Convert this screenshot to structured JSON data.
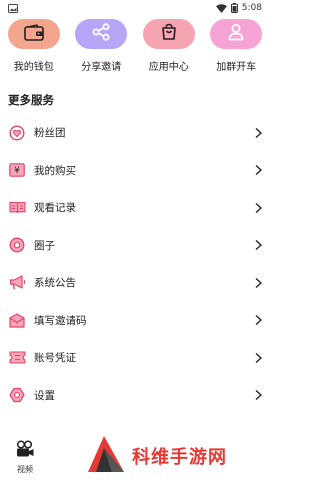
{
  "status_bar": {
    "time": "5:08"
  },
  "quick_actions": [
    {
      "label": "我的钱包",
      "color": "#f4a58d",
      "icon": "wallet-icon"
    },
    {
      "label": "分享邀请",
      "color": "#b9a5f7",
      "icon": "share-icon"
    },
    {
      "label": "应用中心",
      "color": "#f6a3b2",
      "icon": "shopping-bag-icon"
    },
    {
      "label": "加群开车",
      "color": "#f6a3d6",
      "icon": "user-group-icon"
    }
  ],
  "section_title": "更多服务",
  "menu_items": [
    {
      "label": "粉丝团",
      "icon": "heart-badge-icon"
    },
    {
      "label": "我的购买",
      "icon": "yen-card-icon"
    },
    {
      "label": "观看记录",
      "icon": "book-icon"
    },
    {
      "label": "圈子",
      "icon": "circle-dot-icon"
    },
    {
      "label": "系统公告",
      "icon": "megaphone-icon"
    },
    {
      "label": "填写邀请码",
      "icon": "envelope-icon"
    },
    {
      "label": "账号凭证",
      "icon": "ticket-icon"
    },
    {
      "label": "设置",
      "icon": "hexagon-settings-icon"
    }
  ],
  "bottom_tab": {
    "label": "视频",
    "icon": "video-camera-icon"
  },
  "watermark": {
    "text": "科维手游网"
  },
  "colors": {
    "icon_red": "#e0456b",
    "icon_fill": "#f8a5b9",
    "accent": "#e53935"
  }
}
